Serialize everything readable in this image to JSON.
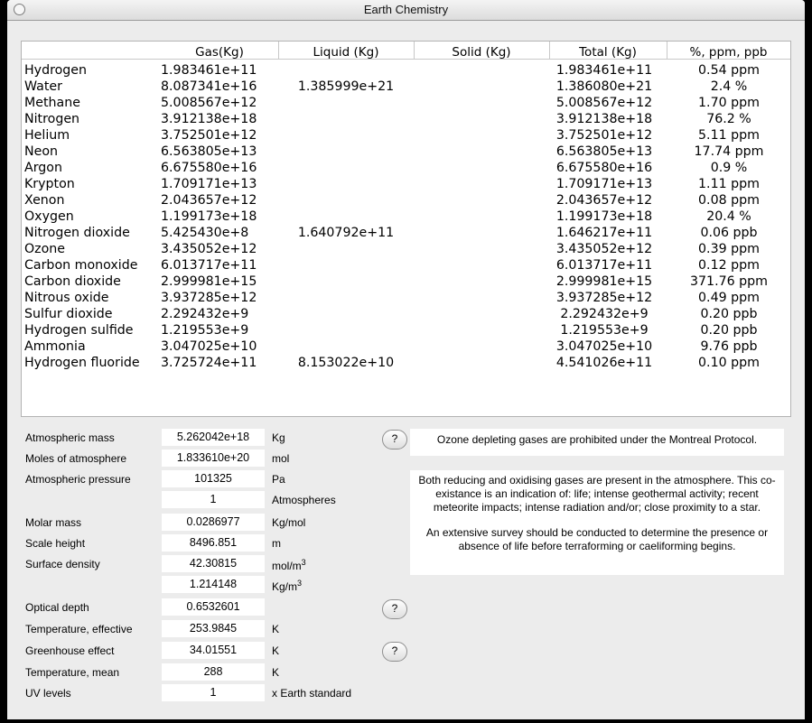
{
  "window": {
    "title": "Earth Chemistry"
  },
  "table": {
    "columns": [
      "Gas(Kg)",
      "Liquid (Kg)",
      "Solid (Kg)",
      "Total (Kg)",
      "%, ppm, ppb"
    ],
    "rows": [
      {
        "name": "Hydrogen",
        "gas": "1.983461e+11",
        "liquid": "",
        "solid": "",
        "total": "1.983461e+11",
        "pct": "0.54 ppm"
      },
      {
        "name": "Water",
        "gas": "8.087341e+16",
        "liquid": "1.385999e+21",
        "solid": "",
        "total": "1.386080e+21",
        "pct": "2.4 %"
      },
      {
        "name": "Methane",
        "gas": "5.008567e+12",
        "liquid": "",
        "solid": "",
        "total": "5.008567e+12",
        "pct": "1.70 ppm"
      },
      {
        "name": "Nitrogen",
        "gas": "3.912138e+18",
        "liquid": "",
        "solid": "",
        "total": "3.912138e+18",
        "pct": "76.2 %"
      },
      {
        "name": "Helium",
        "gas": "3.752501e+12",
        "liquid": "",
        "solid": "",
        "total": "3.752501e+12",
        "pct": "5.11 ppm"
      },
      {
        "name": "Neon",
        "gas": "6.563805e+13",
        "liquid": "",
        "solid": "",
        "total": "6.563805e+13",
        "pct": "17.74 ppm"
      },
      {
        "name": "Argon",
        "gas": "6.675580e+16",
        "liquid": "",
        "solid": "",
        "total": "6.675580e+16",
        "pct": "0.9 %"
      },
      {
        "name": "Krypton",
        "gas": "1.709171e+13",
        "liquid": "",
        "solid": "",
        "total": "1.709171e+13",
        "pct": "1.11 ppm"
      },
      {
        "name": "Xenon",
        "gas": "2.043657e+12",
        "liquid": "",
        "solid": "",
        "total": "2.043657e+12",
        "pct": "0.08 ppm"
      },
      {
        "name": "Oxygen",
        "gas": "1.199173e+18",
        "liquid": "",
        "solid": "",
        "total": "1.199173e+18",
        "pct": "20.4 %"
      },
      {
        "name": "Nitrogen dioxide",
        "gas": "5.425430e+8",
        "liquid": "1.640792e+11",
        "solid": "",
        "total": "1.646217e+11",
        "pct": "0.06 ppb"
      },
      {
        "name": "Ozone",
        "gas": "3.435052e+12",
        "liquid": "",
        "solid": "",
        "total": "3.435052e+12",
        "pct": "0.39 ppm"
      },
      {
        "name": "Carbon monoxide",
        "gas": "6.013717e+11",
        "liquid": "",
        "solid": "",
        "total": "6.013717e+11",
        "pct": "0.12 ppm"
      },
      {
        "name": "Carbon dioxide",
        "gas": "2.999981e+15",
        "liquid": "",
        "solid": "",
        "total": "2.999981e+15",
        "pct": "371.76 ppm"
      },
      {
        "name": "Nitrous oxide",
        "gas": "3.937285e+12",
        "liquid": "",
        "solid": "",
        "total": "3.937285e+12",
        "pct": "0.49 ppm"
      },
      {
        "name": "Sulfur dioxide",
        "gas": "2.292432e+9",
        "liquid": "",
        "solid": "",
        "total": "2.292432e+9",
        "pct": "0.20 ppb"
      },
      {
        "name": "Hydrogen sulfide",
        "gas": "1.219553e+9",
        "liquid": "",
        "solid": "",
        "total": "1.219553e+9",
        "pct": "0.20 ppb"
      },
      {
        "name": "Ammonia",
        "gas": "3.047025e+10",
        "liquid": "",
        "solid": "",
        "total": "3.047025e+10",
        "pct": "9.76 ppb"
      },
      {
        "name": "Hydrogen fluoride",
        "gas": "3.725724e+11",
        "liquid": "8.153022e+10",
        "solid": "",
        "total": "4.541026e+11",
        "pct": "0.10 ppm"
      }
    ]
  },
  "properties": {
    "atmospheric_mass": {
      "label": "Atmospheric mass",
      "value": "5.262042e+18",
      "unit": "Kg"
    },
    "moles": {
      "label": "Moles of atmosphere",
      "value": "1.833610e+20",
      "unit": "mol"
    },
    "pressure": {
      "label": "Atmospheric pressure",
      "value": "101325",
      "unit": "Pa"
    },
    "pressure_atm": {
      "label": "",
      "value": "1",
      "unit": "Atmospheres"
    },
    "molar_mass": {
      "label": "Molar mass",
      "value": "0.0286977",
      "unit": "Kg/mol"
    },
    "scale_height": {
      "label": "Scale height",
      "value": "8496.851",
      "unit": "m"
    },
    "surface_density": {
      "label": "Surface density",
      "value": "42.30815",
      "unit": "mol/m",
      "unit_sup": "3"
    },
    "surface_density_kg": {
      "label": "",
      "value": "1.214148",
      "unit": "Kg/m",
      "unit_sup": "3"
    },
    "optical_depth": {
      "label": "Optical depth",
      "value": "0.6532601",
      "unit": ""
    },
    "temp_effective": {
      "label": "Temperature, effective",
      "value": "253.9845",
      "unit": "K"
    },
    "greenhouse": {
      "label": "Greenhouse effect",
      "value": "34.01551",
      "unit": "K"
    },
    "temp_mean": {
      "label": "Temperature, mean",
      "value": "288",
      "unit": "K"
    },
    "uv_levels": {
      "label": "UV levels",
      "value": "1",
      "unit": "x Earth standard"
    }
  },
  "help_button": {
    "label": "?"
  },
  "messages": {
    "ozone": "Ozone depleting gases are prohibited under the Montreal Protocol.",
    "coexistence": "Both reducing and oxidising gases are present in the atmosphere. This co-existance is an indication of: life; intense geothermal activity; recent meteorite impacts; intense radiation and/or; close proximity to a star.",
    "survey": "An extensive survey should be conducted to determine the presence or absence of life before terraforming or caeliforming begins."
  }
}
